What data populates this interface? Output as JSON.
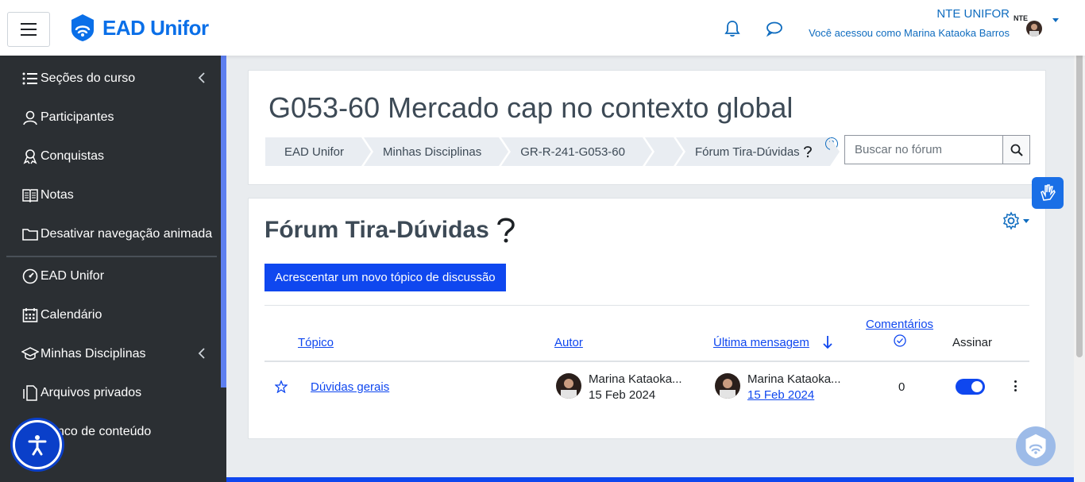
{
  "header": {
    "menu_icon": "hamburger-icon",
    "logo_text": "EAD Unifor",
    "notifications_icon": "bell-icon",
    "messages_icon": "chat-icon",
    "org_name": "NTE UNIFOR",
    "logged_in_text": "Você acessou como Marina Kataoka Barros",
    "org_badge": "NTE"
  },
  "sidebar": {
    "items": [
      {
        "label": "Seções do curso",
        "icon": "list-icon"
      },
      {
        "label": "Participantes",
        "icon": "user-icon"
      },
      {
        "label": "Conquistas",
        "icon": "award-icon"
      },
      {
        "label": "Notas",
        "icon": "book-icon"
      },
      {
        "label": "Desativar navegação animada",
        "icon": "folder-icon"
      },
      {
        "label": "EAD Unifor",
        "icon": "dashboard-icon"
      },
      {
        "label": "Calendário",
        "icon": "calendar-icon"
      },
      {
        "label": "Minhas Disciplinas",
        "icon": "graduation-cap-icon"
      },
      {
        "label": "Arquivos privados",
        "icon": "file-icon"
      },
      {
        "label": "nco de conteúdo",
        "icon": "database-icon"
      }
    ]
  },
  "course": {
    "title": "G053-60 Mercado cap no contexto global",
    "breadcrumb": [
      "EAD Unifor",
      "Minhas Disciplinas",
      "GR-R-241-G053-60",
      "",
      "Fórum Tira-Dúvidas"
    ],
    "search_placeholder": "Buscar no fórum"
  },
  "forum": {
    "title": "Fórum Tira-Dúvidas",
    "add_button": "Acrescentar um novo tópico de discussão",
    "columns": {
      "topic": "Tópico",
      "author": "Autor",
      "last_post": "Última mensagem",
      "comments": "Comentários",
      "subscribe": "Assinar"
    },
    "rows": [
      {
        "topic": "Dúvidas gerais",
        "author_name": "Marina Kataoka...",
        "author_date": "15 Feb 2024",
        "last_name": "Marina Kataoka...",
        "last_date": "15 Feb 2024",
        "comments": "0",
        "subscribed": true
      }
    ]
  },
  "colors": {
    "primary": "#0f47ef",
    "sidebar_bg": "#2b2f33",
    "logo_blue": "#0a6fe8"
  }
}
